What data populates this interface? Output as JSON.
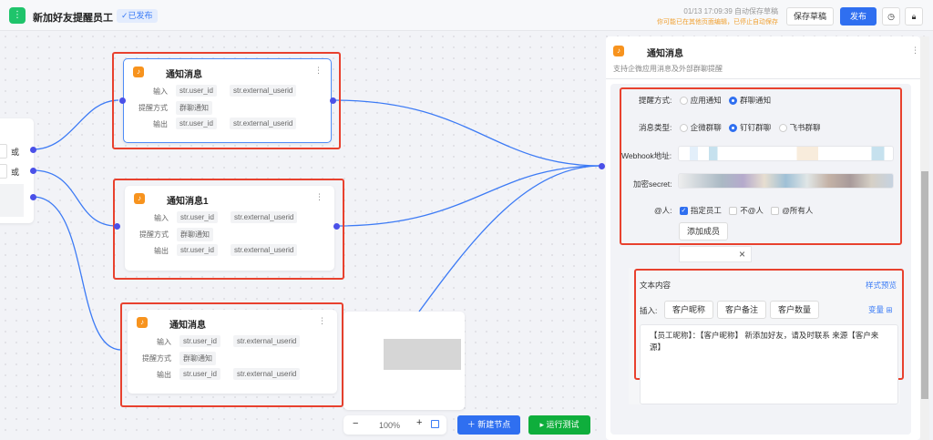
{
  "header": {
    "title": "新加好友提醒员工",
    "status": "已发布",
    "save_time": "01/13 17:09:39 自动保存草稿",
    "warning": "你可能已在其他页面编辑，已停止自动保存",
    "save_draft": "保存草稿",
    "publish": "发布"
  },
  "left_node": {
    "or1": "或",
    "or2": "或"
  },
  "nodes": [
    {
      "title": "通知消息",
      "input_label": "输入",
      "input_a": "str.user_id",
      "input_b": "str.external_userid",
      "mode_label": "提醒方式",
      "mode": "群聊通知",
      "output_label": "输出",
      "output_a": "str.user_id",
      "output_b": "str.external_userid"
    },
    {
      "title": "通知消息1",
      "input_label": "输入",
      "input_a": "str.user_id",
      "input_b": "str.external_userid",
      "mode_label": "提醒方式",
      "mode": "群聊通知",
      "output_label": "输出",
      "output_a": "str.user_id",
      "output_b": "str.external_userid"
    },
    {
      "title": "通知消息",
      "input_label": "输入",
      "input_a": "str.user_id",
      "input_b": "str.external_userid",
      "mode_label": "提醒方式",
      "mode": "群聊通知",
      "output_label": "输出",
      "output_a": "str.user_id",
      "output_b": "str.external_userid"
    }
  ],
  "toolbar": {
    "zoom": "100%",
    "new_node": "新建节点",
    "run_test": "运行测试"
  },
  "panel": {
    "title": "通知消息",
    "subtitle": "支持企微应用消息及外部群聊提醒",
    "remind_label": "提醒方式:",
    "remind_options": [
      "应用通知",
      "群聊通知"
    ],
    "remind_selected": 1,
    "type_label": "消息类型:",
    "type_options": [
      "企微群聊",
      "钉钉群聊",
      "飞书群聊"
    ],
    "type_selected": 1,
    "webhook_label": "Webhook地址:",
    "secret_label": "加密secret:",
    "at_label": "@人:",
    "at_options": [
      "指定员工",
      "不@人",
      "@所有人"
    ],
    "at_checked": [
      true,
      false,
      false
    ],
    "add_member": "添加成员",
    "text_label": "文本内容",
    "preview": "样式预览",
    "insert_label": "插入:",
    "insert_buttons": [
      "客户昵称",
      "客户备注",
      "客户数量"
    ],
    "variable": "变量",
    "content": "【员工昵称】：【客户昵称】 新添加好友，请及时联系  来源【客户来源】"
  },
  "colors": {
    "primary": "#2f6ff0",
    "success": "#0fae3c",
    "highlight": "#e8412e",
    "bell": "#f7931e"
  }
}
